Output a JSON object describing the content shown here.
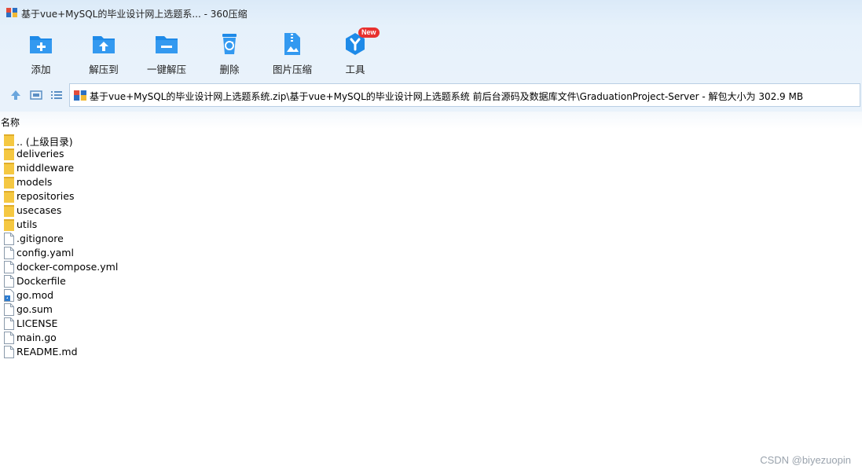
{
  "window": {
    "title": "基于vue+MySQL的毕业设计网上选题系... - 360压缩"
  },
  "toolbar": {
    "add": "添加",
    "extract_to": "解压到",
    "one_click_extract": "一键解压",
    "delete": "删除",
    "image_compress": "图片压缩",
    "tools": "工具",
    "tools_badge": "New"
  },
  "address": {
    "path": "基于vue+MySQL的毕业设计网上选题系统.zip\\基于vue+MySQL的毕业设计网上选题系统 前后台源码及数据库文件\\GraduationProject-Server - 解包大小为 302.9 MB"
  },
  "list": {
    "column_name": "名称",
    "items": [
      {
        "name": ".. (上级目录)",
        "type": "folder"
      },
      {
        "name": "deliveries",
        "type": "folder"
      },
      {
        "name": "middleware",
        "type": "folder"
      },
      {
        "name": "models",
        "type": "folder"
      },
      {
        "name": "repositories",
        "type": "folder"
      },
      {
        "name": "usecases",
        "type": "folder"
      },
      {
        "name": "utils",
        "type": "folder"
      },
      {
        "name": ".gitignore",
        "type": "file"
      },
      {
        "name": "config.yaml",
        "type": "file"
      },
      {
        "name": "docker-compose.yml",
        "type": "file"
      },
      {
        "name": "Dockerfile",
        "type": "file"
      },
      {
        "name": "go.mod",
        "type": "special"
      },
      {
        "name": "go.sum",
        "type": "file"
      },
      {
        "name": "LICENSE",
        "type": "file"
      },
      {
        "name": "main.go",
        "type": "file"
      },
      {
        "name": "README.md",
        "type": "file"
      }
    ]
  },
  "watermark": "CSDN @biyezuopin",
  "colors": {
    "accent": "#1e8ae8",
    "folder": "#f5c842",
    "badge": "#e8312f"
  }
}
